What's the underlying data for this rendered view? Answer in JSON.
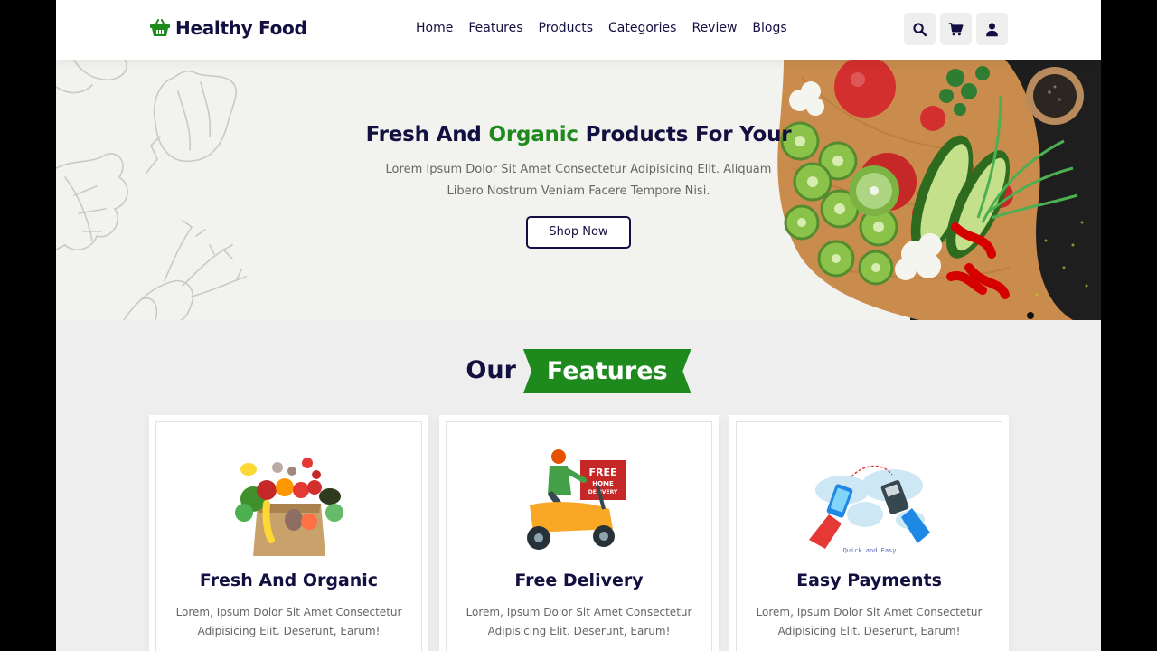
{
  "brand": {
    "name": "Healthy Food",
    "color": "#1e8a1e",
    "dark": "#130f40"
  },
  "nav": [
    "Home",
    "Features",
    "Products",
    "Categories",
    "Review",
    "Blogs"
  ],
  "header_icons": [
    "search-icon",
    "cart-icon",
    "user-icon"
  ],
  "hero": {
    "title_start": "Fresh And ",
    "title_accent": "Organic",
    "title_end": " Products For Your",
    "text": "Lorem Ipsum Dolor Sit Amet Consectetur Adipisicing Elit. Aliquam Libero Nostrum Veniam Facere Tempore Nisi.",
    "button": "Shop Now"
  },
  "features": {
    "heading_plain": "Our",
    "heading_accent": "Features",
    "cards": [
      {
        "title": "Fresh And Organic",
        "text": "Lorem, Ipsum Dolor Sit Amet Consectetur Adipisicing Elit. Deserunt, Earum!"
      },
      {
        "title": "Free Delivery",
        "text": "Lorem, Ipsum Dolor Sit Amet Consectetur Adipisicing Elit. Deserunt, Earum!",
        "badge_line1": "FREE",
        "badge_line2": "HOME",
        "badge_line3": "DELIVERY"
      },
      {
        "title": "Easy Payments",
        "text": "Lorem, Ipsum Dolor Sit Amet Consectetur Adipisicing Elit. Deserunt, Earum!",
        "caption": "Quick and Easy"
      }
    ]
  }
}
